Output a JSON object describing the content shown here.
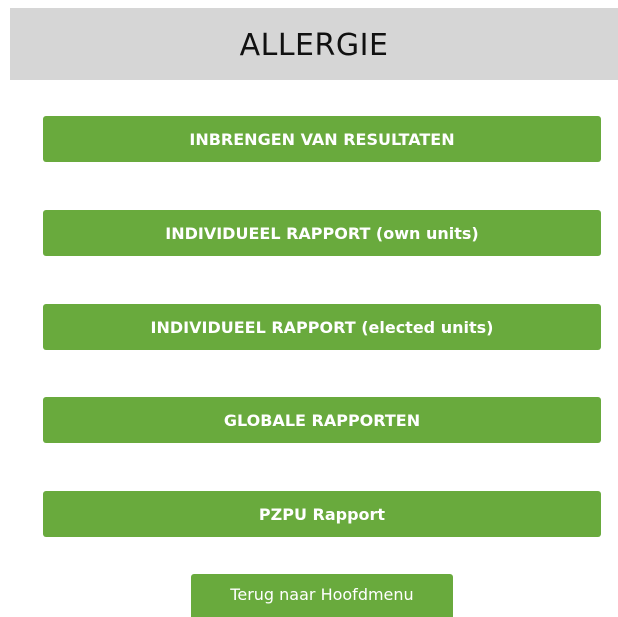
{
  "header": {
    "title": "ALLERGIE"
  },
  "menu": {
    "buttons": [
      {
        "label": "INBRENGEN VAN RESULTATEN"
      },
      {
        "label": "INDIVIDUEEL RAPPORT (own units)"
      },
      {
        "label": "INDIVIDUEEL RAPPORT (elected units)"
      },
      {
        "label": "GLOBALE RAPPORTEN"
      },
      {
        "label": "PZPU Rapport"
      }
    ],
    "back_label": "Terug naar Hoofdmenu"
  },
  "colors": {
    "header_bg": "#d6d6d6",
    "button_bg": "#69aa3d",
    "button_text": "#ffffff"
  }
}
